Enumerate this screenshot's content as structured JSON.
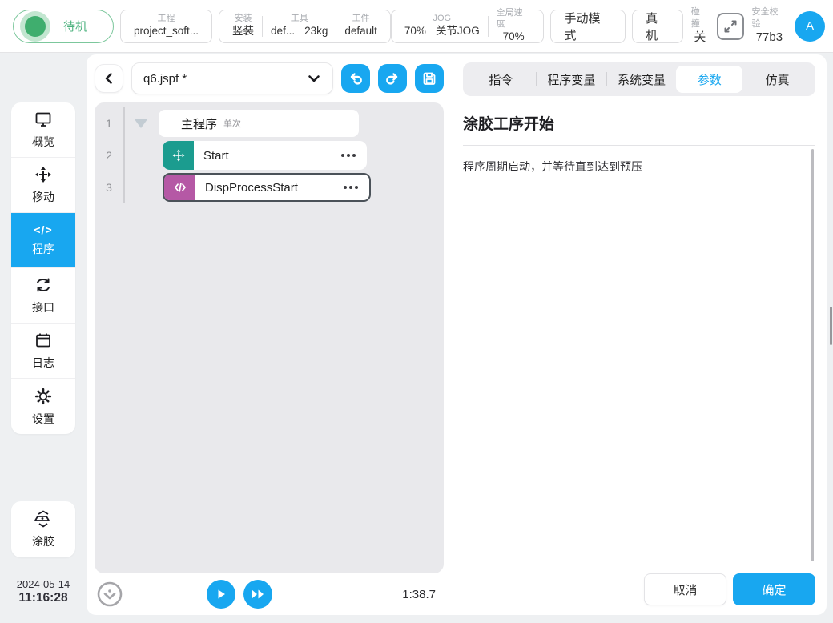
{
  "topbar": {
    "status": {
      "label": "待机"
    },
    "project": {
      "label": "工程",
      "value": "project_soft..."
    },
    "mount": {
      "label": "安装",
      "value": "竖装"
    },
    "tool": {
      "label": "工具",
      "value_1": "def...",
      "value_2": "23kg"
    },
    "workpiece": {
      "label": "工件",
      "value": "default"
    },
    "jog": {
      "label": "JOG",
      "value_1": "70%",
      "value_2": "关节JOG"
    },
    "global_speed": {
      "label": "全局速度",
      "value": "70%"
    },
    "mode_button": "手动模式",
    "machine_button": "真机",
    "collision": {
      "label": "碰撞",
      "value": "关"
    },
    "safety": {
      "label": "安全校验",
      "value": "77b3"
    },
    "avatar": "A"
  },
  "sidebar": {
    "items": [
      {
        "label": "概览"
      },
      {
        "label": "移动"
      },
      {
        "label": "程序"
      },
      {
        "label": "接口"
      },
      {
        "label": "日志"
      },
      {
        "label": "设置"
      }
    ],
    "active_item": "程序",
    "code_glyph": "</>",
    "glue": {
      "label": "涂胶"
    },
    "date": "2024-05-14",
    "time": "11:16:28"
  },
  "editor": {
    "file_name": "q6.jspf *",
    "rows": [
      {
        "line": "1",
        "label": "主程序",
        "tag": "单次"
      },
      {
        "line": "2",
        "label": "Start"
      },
      {
        "line": "3",
        "label": "DispProcessStart",
        "selected": true
      }
    ],
    "runtime": "1:38.7"
  },
  "panel": {
    "tabs": [
      {
        "label": "指令"
      },
      {
        "label": "程序变量"
      },
      {
        "label": "系统变量"
      },
      {
        "label": "参数"
      },
      {
        "label": "仿真"
      }
    ],
    "active_tab": "参数",
    "title": "涂胶工序开始",
    "description": "程序周期启动，并等待直到达到预压",
    "cancel_label": "取消",
    "confirm_label": "确定"
  },
  "colors": {
    "accent_blue": "#18a7f0",
    "status_green": "#4cb27e",
    "move_teal": "#1b9c8f",
    "code_magenta": "#b558a5"
  }
}
